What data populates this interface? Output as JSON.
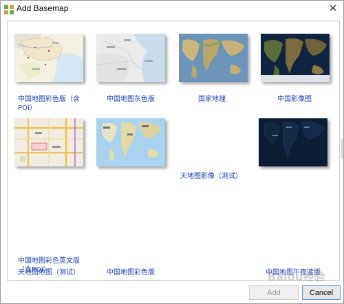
{
  "window": {
    "title": "Add Basemap",
    "close_symbol": "✕"
  },
  "basemaps": [
    {
      "label_line1": "中国地图彩色版（含",
      "label_line2": "POI）"
    },
    {
      "label_line1": "中国地图灰色版",
      "label_line2": ""
    },
    {
      "label_line1": "国家地理",
      "label_line2": ""
    },
    {
      "label_line1": "中国影像图",
      "label_line2": ""
    },
    {
      "label_line1": "天地图地图（测试）",
      "label_line2": ""
    },
    {
      "label_line1": "中国地图彩色版",
      "label_line2": ""
    },
    {
      "label_line1": "天地图影像（测试）",
      "label_line2": ""
    },
    {
      "label_line1": "中国地图午夜蓝版",
      "label_line2": ""
    },
    {
      "label_line1": "中国地图彩色英文版",
      "label_line2": "（含POI）"
    }
  ],
  "buttons": {
    "add": "Add",
    "cancel": "Cancel"
  },
  "watermark": "Baidu经验"
}
